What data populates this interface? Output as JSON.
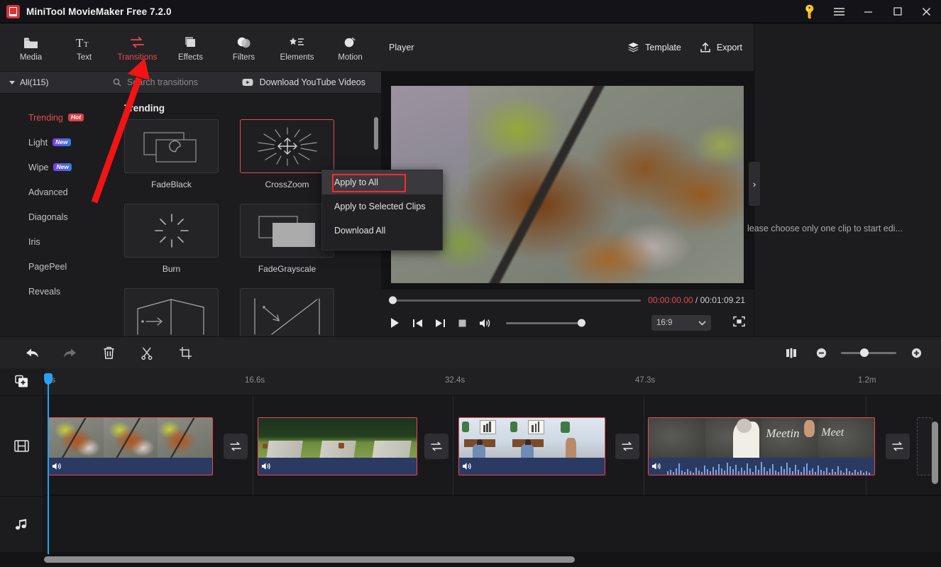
{
  "window": {
    "title": "MiniTool MovieMaker Free 7.2.0",
    "logo_icon": "app-logo-icon",
    "controls": {
      "key": "key-icon",
      "menu": "hamburger-menu-icon",
      "minimize": "minimize-icon",
      "maximize": "maximize-icon",
      "close": "close-icon"
    }
  },
  "toolbar": {
    "items": [
      {
        "label": "Media",
        "icon": "folder-icon",
        "active": false
      },
      {
        "label": "Text",
        "icon": "text-icon",
        "active": false
      },
      {
        "label": "Transitions",
        "icon": "transitions-icon",
        "active": true
      },
      {
        "label": "Effects",
        "icon": "effects-icon",
        "active": false
      },
      {
        "label": "Filters",
        "icon": "filters-icon",
        "active": false
      },
      {
        "label": "Elements",
        "icon": "elements-icon",
        "active": false
      },
      {
        "label": "Motion",
        "icon": "motion-icon",
        "active": false
      }
    ]
  },
  "library": {
    "all_label": "All(115)",
    "search_placeholder": "Search transitions",
    "search_icon": "search-icon",
    "download_youtube_label": "Download YouTube Videos",
    "download_youtube_icon": "youtube-icon",
    "categories": [
      {
        "label": "Trending",
        "badge": "Hot",
        "badge_type": "hot",
        "selected": true
      },
      {
        "label": "Light",
        "badge": "New",
        "badge_type": "new",
        "selected": false
      },
      {
        "label": "Wipe",
        "badge": "New",
        "badge_type": "new",
        "selected": false
      },
      {
        "label": "Advanced",
        "badge": "",
        "badge_type": "",
        "selected": false
      },
      {
        "label": "Diagonals",
        "badge": "",
        "badge_type": "",
        "selected": false
      },
      {
        "label": "Iris",
        "badge": "",
        "badge_type": "",
        "selected": false
      },
      {
        "label": "PagePeel",
        "badge": "",
        "badge_type": "",
        "selected": false
      },
      {
        "label": "Reveals",
        "badge": "",
        "badge_type": "",
        "selected": false
      }
    ],
    "section_title": "Trending",
    "transitions": [
      {
        "name": "FadeBlack",
        "icon": "fade-black-icon",
        "selected": false
      },
      {
        "name": "CrossZoom",
        "icon": "cross-zoom-icon",
        "selected": true
      },
      {
        "name": "Burn",
        "icon": "burn-icon",
        "selected": false
      },
      {
        "name": "FadeGrayscale",
        "icon": "fade-grayscale-icon",
        "selected": false
      },
      {
        "name": "",
        "icon": "arrow-right-transition-icon",
        "selected": false
      },
      {
        "name": "",
        "icon": "diagonal-transition-icon",
        "selected": false
      }
    ]
  },
  "context_menu": {
    "items": [
      {
        "label": "Apply to All",
        "highlighted": true
      },
      {
        "label": "Apply to Selected Clips",
        "highlighted": false
      },
      {
        "label": "Download All",
        "highlighted": false
      }
    ]
  },
  "player": {
    "title": "Player",
    "template_label": "Template",
    "template_icon": "layers-icon",
    "export_label": "Export",
    "export_icon": "export-icon",
    "current_time": "00:00:00.00",
    "time_separator": " / ",
    "total_time": "00:01:09.21",
    "aspect_ratio": "16:9",
    "controls": {
      "play": "play-icon",
      "prev_frame": "previous-frame-icon",
      "next_frame": "next-frame-icon",
      "stop": "stop-icon",
      "volume": "volume-icon",
      "fullscreen": "fullscreen-icon",
      "ratio_caret": "chevron-down-icon"
    }
  },
  "right_panel": {
    "message": "lease choose only one clip to start edi...",
    "collapse_icon": "chevron-right-icon"
  },
  "timeline": {
    "toolbar": [
      {
        "name": "undo",
        "icon": "undo-icon",
        "enabled": true
      },
      {
        "name": "redo",
        "icon": "redo-icon",
        "enabled": false
      },
      {
        "name": "delete",
        "icon": "trash-icon",
        "enabled": true
      },
      {
        "name": "split",
        "icon": "scissors-icon",
        "enabled": true
      },
      {
        "name": "crop",
        "icon": "crop-icon",
        "enabled": true
      }
    ],
    "zoom": {
      "fit_icon": "fit-to-window-icon",
      "minus_icon": "zoom-out-icon",
      "plus_icon": "zoom-in-icon",
      "value": 35
    },
    "gutter": {
      "add_media_icon": "add-media-icon",
      "video_track_icon": "film-icon",
      "audio_track_icon": "music-note-icon"
    },
    "ruler_ticks": [
      "0s",
      "16.6s",
      "32.4s",
      "47.3s",
      "1.2m"
    ],
    "clips": [
      {
        "name": "autumn-leaves-clip",
        "selected": true,
        "has_audio": true,
        "waveform": false
      },
      {
        "name": "countryside-road-clip",
        "selected": true,
        "has_audio": true,
        "waveform": false
      },
      {
        "name": "classroom-meeting-clip",
        "selected": true,
        "has_audio": true,
        "waveform": false
      },
      {
        "name": "chalkboard-writing-clip",
        "selected": true,
        "has_audio": true,
        "waveform": true
      }
    ],
    "transition_slot_icon": "transition-slot-icon",
    "playhead_position": "0s"
  }
}
